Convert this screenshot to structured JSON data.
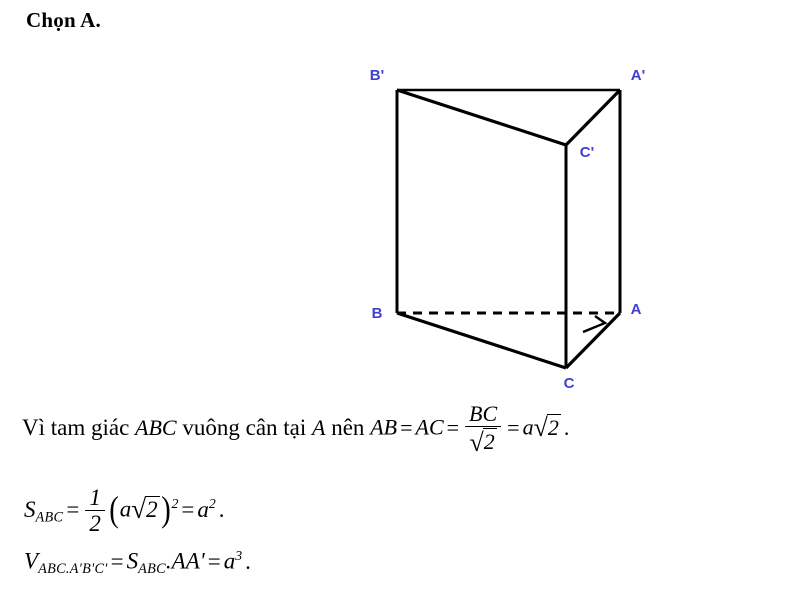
{
  "heading": {
    "text": "Chọn A."
  },
  "figure": {
    "name": "triangular-prism-ABC-A'B'C'",
    "stroke_color": "#000000",
    "label_color": "#4040d0",
    "labels": {
      "top_back_left": "B'",
      "top_back_right": "A'",
      "top_front": "C'",
      "bottom_back_left": "B",
      "bottom_back_right": "A",
      "bottom_front": "C"
    },
    "hidden_edge": "BA",
    "right_angle_at": "A"
  },
  "math": {
    "line1": {
      "lead_text": "Vì tam giác",
      "triangle": "ABC",
      "mid_text": "vuông cân tại",
      "vertex": "A",
      "then_text": "nên",
      "lhs1": "AB",
      "eq": "=",
      "lhs2": "AC",
      "frac_num": "BC",
      "frac_den_radicand": "2",
      "rhs_coeff": "a",
      "rhs_radicand": "2",
      "period": "."
    },
    "line2": {
      "symbol": "S",
      "subscript": "ABC",
      "eq": "=",
      "frac_num": "1",
      "frac_den": "2",
      "group_coeff": "a",
      "group_radicand": "2",
      "group_power": "2",
      "result_base": "a",
      "result_power": "2",
      "period": "."
    },
    "line3": {
      "symbol": "V",
      "subscript": "ABC.A'B'C'",
      "eq1": "=",
      "area_symbol": "S",
      "area_subscript": "ABC",
      "dot": ".",
      "height": "AA'",
      "eq2": "=",
      "result_base": "a",
      "result_power": "3",
      "period": "."
    }
  }
}
